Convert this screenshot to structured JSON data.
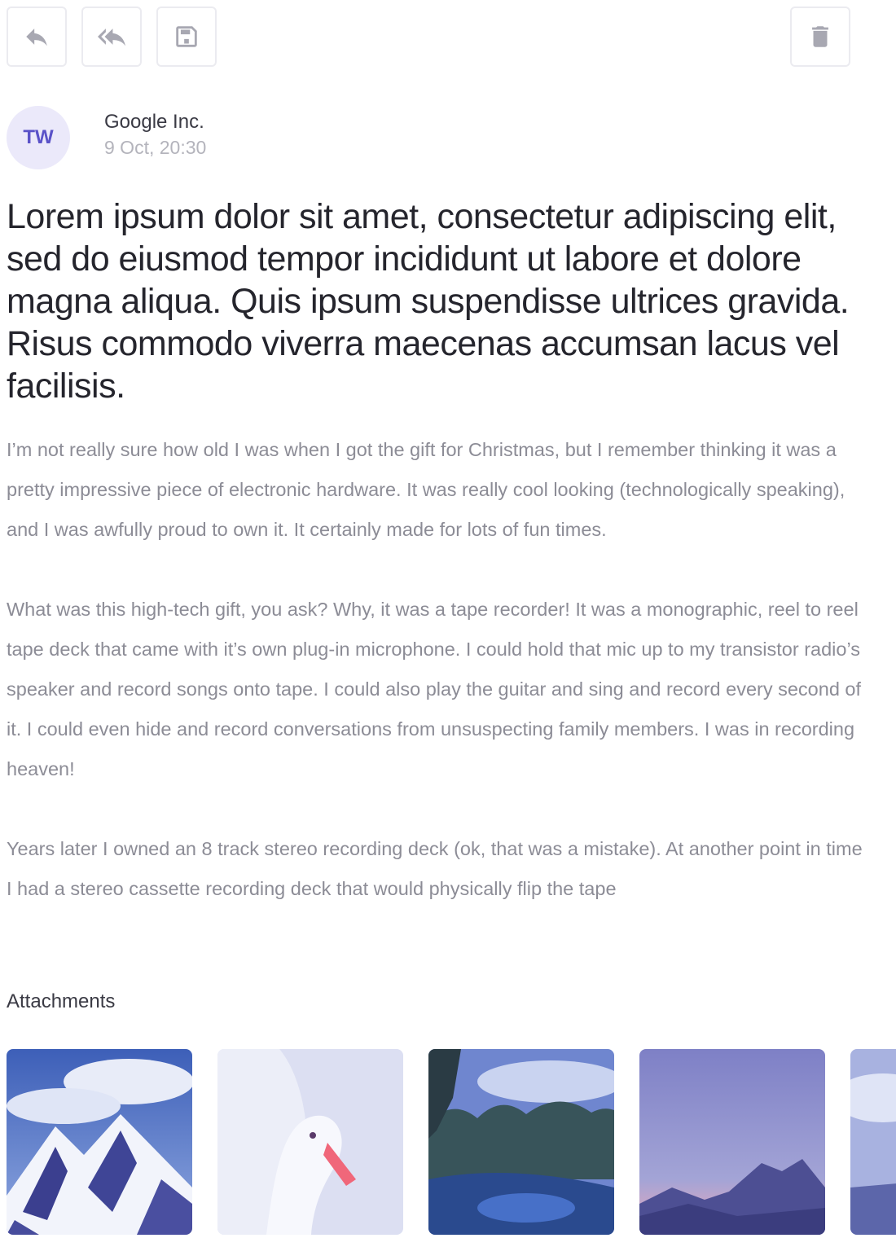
{
  "toolbar": {
    "reply_icon": "reply-icon",
    "reply_all_icon": "reply-all-icon",
    "save_icon": "save-icon",
    "delete_icon": "trash-icon"
  },
  "sender": {
    "initials": "TW",
    "name": "Google Inc.",
    "date": "9 Oct, 20:30"
  },
  "subject": "Lorem ipsum dolor sit amet, consectetur adipiscing elit, sed do eiusmod tempor incididunt ut labore et dolore magna aliqua. Quis ipsum suspendisse ultrices gravida. Risus commodo viverra maecenas accumsan lacus vel facilisis.",
  "body": {
    "paragraphs": [
      "I’m not really sure how old I was when I got the gift for Christmas, but I remember thinking it was a pretty impressive piece of electronic hardware. It was really cool looking (technologically speaking), and I was awfully proud to own it. It certainly made for lots of fun times.",
      "What was this high-tech gift, you ask? Why, it was a tape recorder! It was a monographic, reel to reel tape deck that came with it’s own plug-in microphone. I could hold that mic up to my transistor radio’s speaker and record songs onto tape. I could also play the guitar and sing and record every second of it. I could even hide and record conversations from unsuspecting family members. I was in recording heaven!",
      "Years later I owned an 8 track stereo recording deck (ok, that was a mistake). At another point in time I had a stereo cassette recording deck that would physically flip the tape"
    ]
  },
  "attachments": {
    "title": "Attachments",
    "items": [
      "snowy-mountain-image",
      "white-goose-image",
      "jungle-lake-image",
      "mountain-dusk-image",
      "partial-image"
    ]
  },
  "colors": {
    "accent": "#5a52c8",
    "avatar_bg": "#ebe9fa",
    "body_text": "#8c8c96"
  }
}
